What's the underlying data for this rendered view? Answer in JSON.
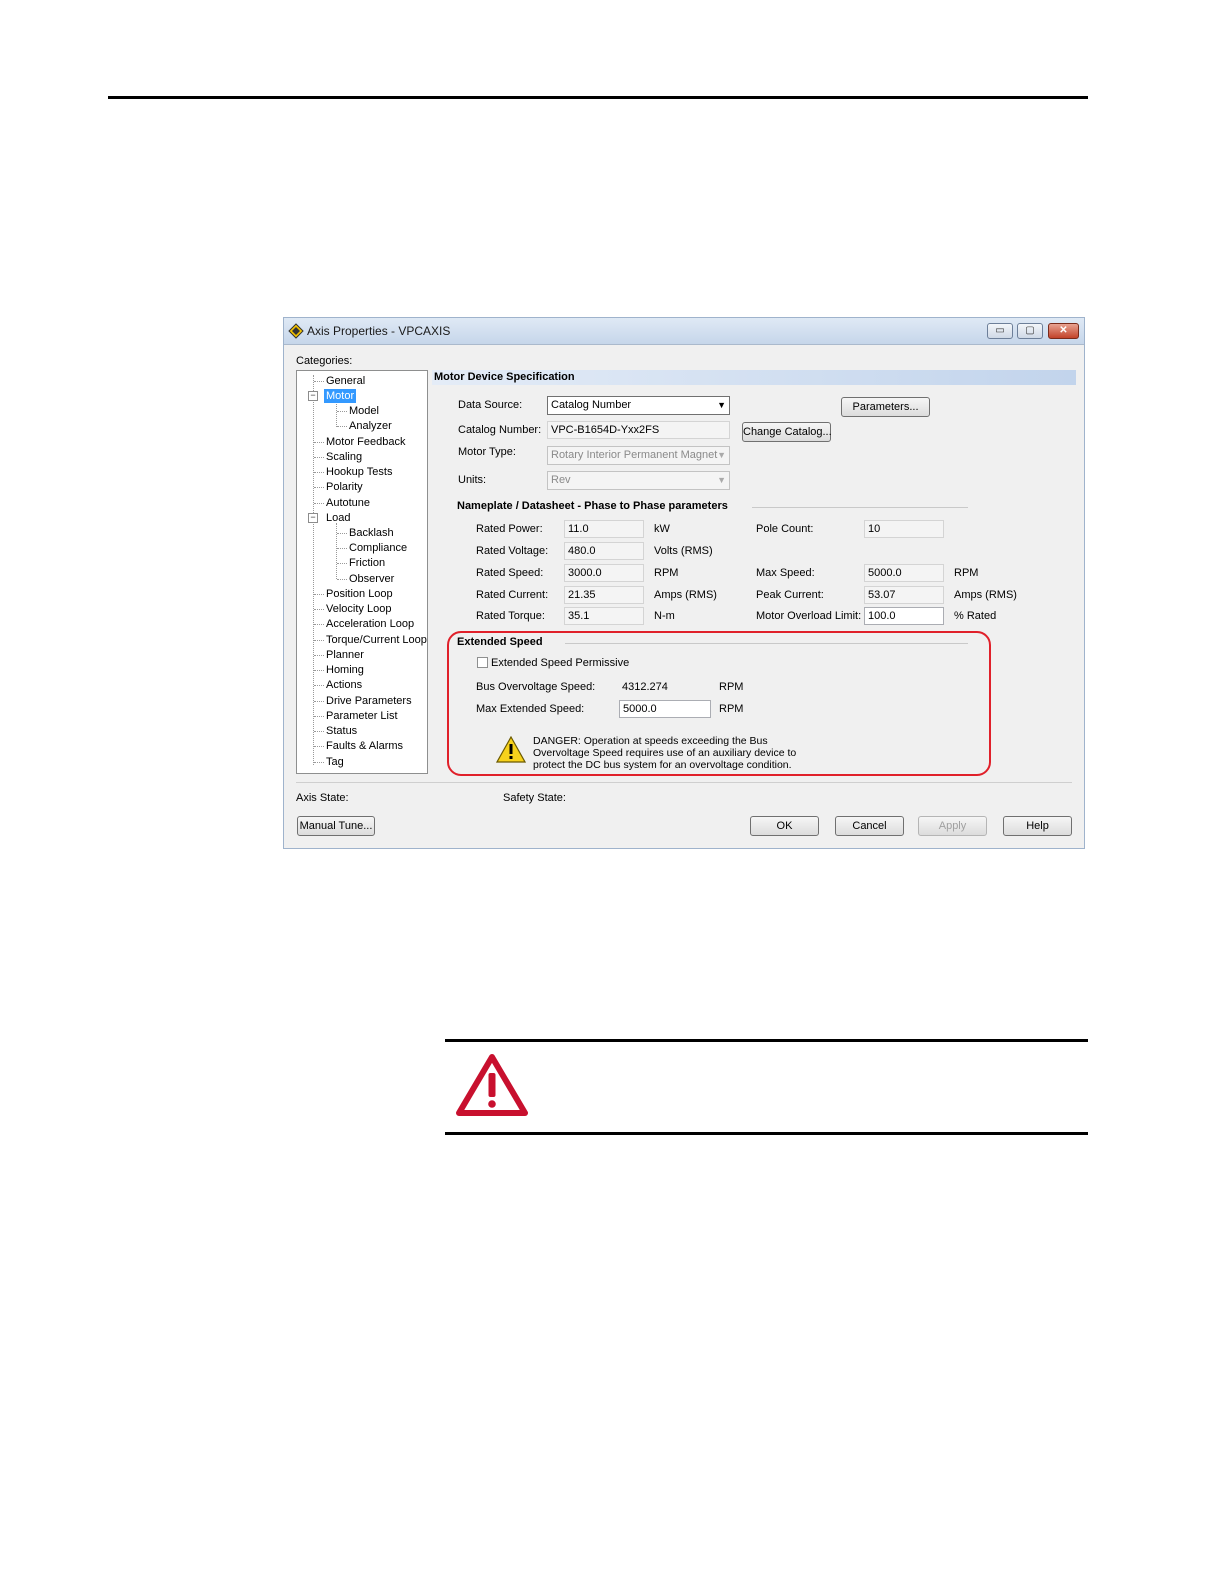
{
  "window": {
    "title": "Axis Properties - VPCAXIS",
    "controls": {
      "minimize": "▭",
      "maximize": "▢",
      "close": "✕"
    }
  },
  "categories": {
    "label": "Categories:",
    "items": [
      "General",
      "Motor",
      "Model",
      "Analyzer",
      "Motor Feedback",
      "Scaling",
      "Hookup Tests",
      "Polarity",
      "Autotune",
      "Load",
      "Backlash",
      "Compliance",
      "Friction",
      "Observer",
      "Position Loop",
      "Velocity Loop",
      "Acceleration Loop",
      "Torque/Current Loop",
      "Planner",
      "Homing",
      "Actions",
      "Drive Parameters",
      "Parameter List",
      "Status",
      "Faults & Alarms",
      "Tag"
    ],
    "selected": "Motor"
  },
  "motor_spec": {
    "header": "Motor Device Specification",
    "data_source_label": "Data Source:",
    "data_source_value": "Catalog Number",
    "parameters_button": "Parameters...",
    "catalog_number_label": "Catalog Number:",
    "catalog_number_value": "VPC-B1654D-Yxx2FS",
    "change_catalog_button": "Change Catalog...",
    "motor_type_label": "Motor Type:",
    "motor_type_value": "Rotary Interior Permanent Magnet",
    "units_label": "Units:",
    "units_value": "Rev"
  },
  "nameplate": {
    "title": "Nameplate / Datasheet - Phase to Phase parameters",
    "rated_power": {
      "label": "Rated Power:",
      "value": "11.0",
      "unit": "kW"
    },
    "rated_voltage": {
      "label": "Rated Voltage:",
      "value": "480.0",
      "unit": "Volts (RMS)"
    },
    "rated_speed": {
      "label": "Rated Speed:",
      "value": "3000.0",
      "unit": "RPM"
    },
    "rated_current": {
      "label": "Rated Current:",
      "value": "21.35",
      "unit": "Amps (RMS)"
    },
    "rated_torque": {
      "label": "Rated Torque:",
      "value": "35.1",
      "unit": "N-m"
    },
    "pole_count": {
      "label": "Pole Count:",
      "value": "10"
    },
    "max_speed": {
      "label": "Max Speed:",
      "value": "5000.0",
      "unit": "RPM"
    },
    "peak_current": {
      "label": "Peak Current:",
      "value": "53.07",
      "unit": "Amps (RMS)"
    },
    "overload_limit": {
      "label": "Motor Overload Limit:",
      "value": "100.0",
      "unit": "% Rated"
    }
  },
  "extended_speed": {
    "title": "Extended Speed",
    "permissive_label": "Extended Speed Permissive",
    "bus_overvoltage_label": "Bus Overvoltage Speed:",
    "bus_overvoltage_value": "4312.274",
    "bus_overvoltage_unit": "RPM",
    "max_extended_label": "Max Extended Speed:",
    "max_extended_value": "5000.0",
    "max_extended_unit": "RPM",
    "danger_line1": "DANGER: Operation at speeds exceeding the Bus",
    "danger_line2": "Overvoltage Speed requires use of an auxiliary device to",
    "danger_line3": "protect the DC bus system for an overvoltage condition."
  },
  "status": {
    "axis_state_label": "Axis State:",
    "safety_state_label": "Safety State:"
  },
  "buttons": {
    "manual_tune": "Manual Tune...",
    "ok": "OK",
    "cancel": "Cancel",
    "apply": "Apply",
    "help": "Help"
  },
  "colors": {
    "highlight": "#e0202a",
    "selection": "#3399ff",
    "warning_red": "#c8102e"
  },
  "icons": [
    "axis-properties-icon",
    "warning-triangle-icon",
    "danger-warning-icon"
  ]
}
